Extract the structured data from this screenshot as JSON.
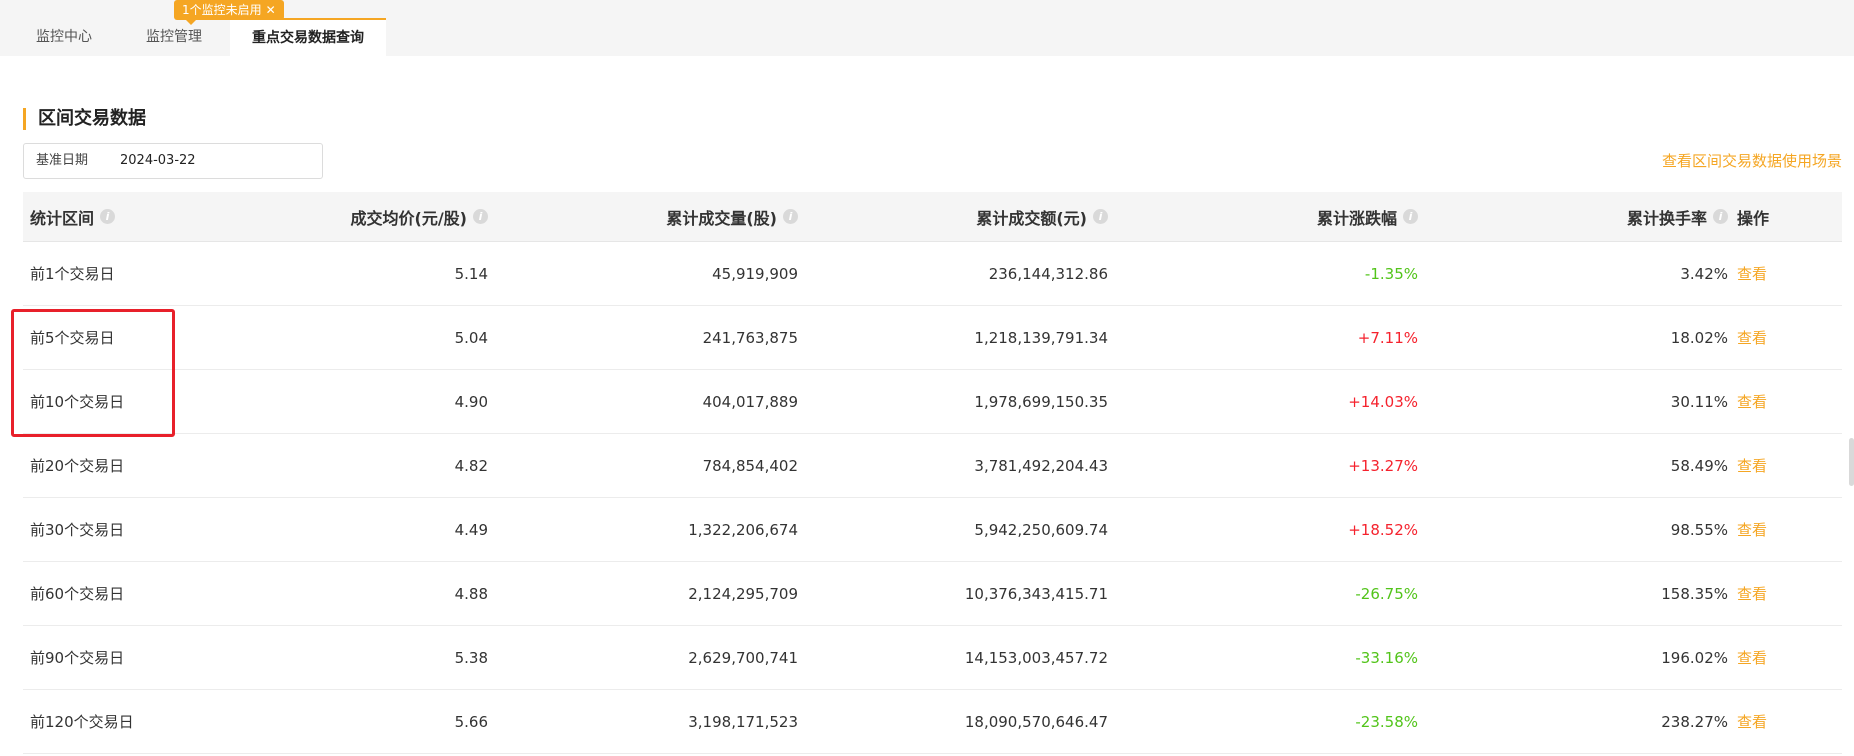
{
  "tabs": [
    {
      "label": "监控中心",
      "active": false
    },
    {
      "label": "监控管理",
      "active": false
    },
    {
      "label": "重点交易数据查询",
      "active": true
    }
  ],
  "badge": {
    "text": "1个监控未启用",
    "close": "✕"
  },
  "section": {
    "title": "区间交易数据"
  },
  "date_field": {
    "label": "基准日期",
    "value": "2024-03-22"
  },
  "scene_link": "查看区间交易数据使用场景",
  "table": {
    "headers": [
      "统计区间",
      "成交均价(元/股)",
      "累计成交量(股)",
      "累计成交额(元)",
      "累计涨跌幅",
      "累计换手率",
      "操作"
    ],
    "info_icon": "i",
    "rows": [
      {
        "period": "前1个交易日",
        "avg_price": "5.14",
        "volume": "45,919,909",
        "amount": "236,144,312.86",
        "change": "-1.35%",
        "turnover": "3.42%",
        "action": "查看"
      },
      {
        "period": "前5个交易日",
        "avg_price": "5.04",
        "volume": "241,763,875",
        "amount": "1,218,139,791.34",
        "change": "+7.11%",
        "turnover": "18.02%",
        "action": "查看"
      },
      {
        "period": "前10个交易日",
        "avg_price": "4.90",
        "volume": "404,017,889",
        "amount": "1,978,699,150.35",
        "change": "+14.03%",
        "turnover": "30.11%",
        "action": "查看"
      },
      {
        "period": "前20个交易日",
        "avg_price": "4.82",
        "volume": "784,854,402",
        "amount": "3,781,492,204.43",
        "change": "+13.27%",
        "turnover": "58.49%",
        "action": "查看"
      },
      {
        "period": "前30个交易日",
        "avg_price": "4.49",
        "volume": "1,322,206,674",
        "amount": "5,942,250,609.74",
        "change": "+18.52%",
        "turnover": "98.55%",
        "action": "查看"
      },
      {
        "period": "前60个交易日",
        "avg_price": "4.88",
        "volume": "2,124,295,709",
        "amount": "10,376,343,415.71",
        "change": "-26.75%",
        "turnover": "158.35%",
        "action": "查看"
      },
      {
        "period": "前90个交易日",
        "avg_price": "5.38",
        "volume": "2,629,700,741",
        "amount": "14,153,003,457.72",
        "change": "-33.16%",
        "turnover": "196.02%",
        "action": "查看"
      },
      {
        "period": "前120个交易日",
        "avg_price": "5.66",
        "volume": "3,198,171,523",
        "amount": "18,090,570,646.47",
        "change": "-23.58%",
        "turnover": "238.27%",
        "action": "查看"
      }
    ]
  },
  "colors": {
    "accent": "#f5a623",
    "up": "#f5222d",
    "down": "#52c41a",
    "highlight": "#e8202a"
  }
}
